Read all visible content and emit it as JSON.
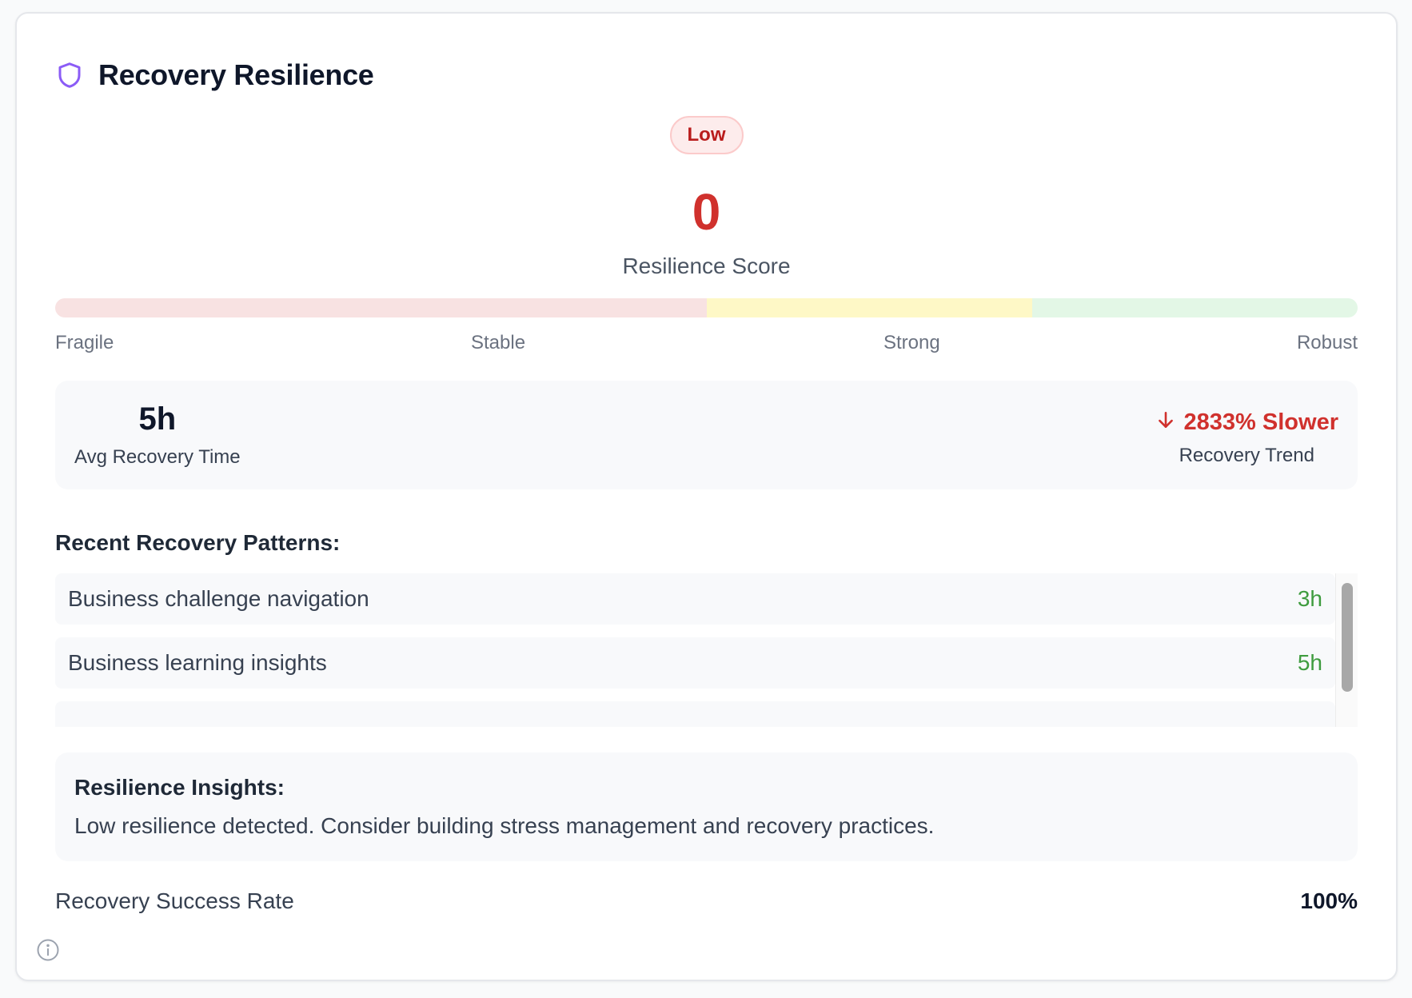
{
  "widget": {
    "title": "Recovery Resilience",
    "level_badge": "Low",
    "score": "0",
    "score_label": "Resilience Score",
    "icons": {
      "title_icon": "shield-icon",
      "trend_icon": "arrow-down-icon",
      "info_icon": "info-icon"
    }
  },
  "scale": {
    "labels": [
      "Fragile",
      "Stable",
      "Strong",
      "Robust"
    ],
    "colors": {
      "fragile": "#f8e2e2",
      "strong": "#fef8c6",
      "robust": "#e3f7e6"
    }
  },
  "stats": {
    "avg_recovery_value": "5h",
    "avg_recovery_label": "Avg Recovery Time",
    "trend_value": "2833% Slower",
    "trend_label": "Recovery Trend"
  },
  "patterns": {
    "title": "Recent Recovery Patterns:",
    "items": [
      {
        "name": "Business challenge navigation",
        "duration": "3h"
      },
      {
        "name": "Business learning insights",
        "duration": "5h"
      }
    ]
  },
  "insights": {
    "title": "Resilience Insights:",
    "text": "Low resilience detected. Consider building stress management and recovery practices."
  },
  "success": {
    "label": "Recovery Success Rate",
    "value": "100%"
  },
  "colors": {
    "accent_purple": "#8b5cf6",
    "danger": "#d0312d",
    "success": "#3f9c3f"
  }
}
